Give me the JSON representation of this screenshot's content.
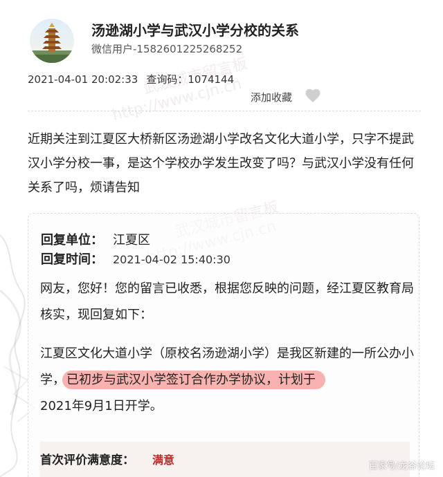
{
  "post": {
    "title": "汤逊湖小学与武汉小学分校的关系",
    "author": "微信用户-1582601225268252",
    "datetime": "2021-04-01 20:02:33",
    "query_code_label": "查询码：",
    "query_code": "1074144",
    "favorite_label": "添加收藏",
    "question": "近期关注到江夏区大桥新区汤逊湖小学改名文化大道小学，只字不提武汉小学分校一事，是这个学校办学发生改变了吗？与武汉小学没有任何关系了吗，烦请告知"
  },
  "reply": {
    "unit_label": "回复单位：",
    "unit_value": "江夏区",
    "time_label": "回复时间：",
    "time_value": "2021-04-02 15:40:30",
    "paragraph1": "网友，您好！您的留言已收悉，根据您反映的问题，经江夏区教育局核实，现回复如下：",
    "paragraph2_part1": "江夏区文化大道小学（原校名汤逊湖小学）是我区新建的一所公办小学，",
    "paragraph2_highlight": "已初步与武汉小学签订合作办学协议，计划于",
    "paragraph2_part2": "2021年9月1日开学。",
    "rating_label": "首次评价满意度：",
    "rating_value": "满意"
  },
  "watermarks": {
    "board_name": "武汉城市留言板",
    "url": "http://www.cjn.cn",
    "source": "百家号/龙谷论坛"
  },
  "icons": {
    "favorite": "heart-icon",
    "avatar": "pagoda-avatar"
  },
  "colors": {
    "highlight": "#f78480",
    "rating": "#c62828",
    "heart": "#cfcfcf"
  }
}
